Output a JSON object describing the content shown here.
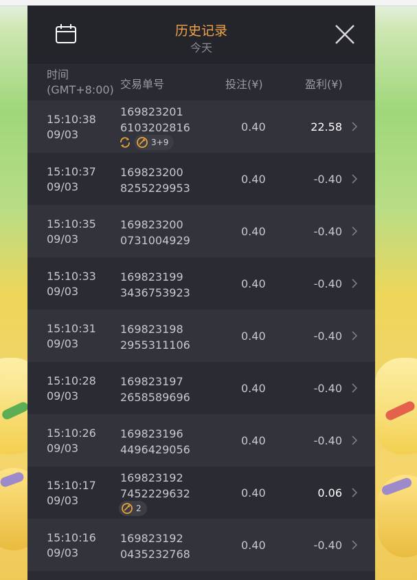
{
  "header": {
    "title": "历史记录",
    "subtitle": "今天",
    "calendar_icon": "calendar-icon",
    "close_icon": "close-icon"
  },
  "columns": {
    "time_line1": "时间",
    "time_line2": "(GMT+8:00)",
    "transaction_id": "交易单号",
    "bet": "投注(¥)",
    "profit": "盈利(¥)"
  },
  "colors": {
    "title": "#f0a44a",
    "panel_bg": "#2b2b33",
    "header_bg": "#24242b",
    "win": "#ffffff",
    "badge_icon": "#e8a43a"
  },
  "rows": [
    {
      "time": "15:10:38",
      "date": "09/03",
      "id_line1": "169823201",
      "id_line2": "6103202816",
      "bet": "0.40",
      "profit": "22.58",
      "win": true,
      "badges": {
        "respin_icon": "respin-icon",
        "feature_icon": "free-spin-icon",
        "count": "3+9"
      }
    },
    {
      "time": "15:10:37",
      "date": "09/03",
      "id_line1": "169823200",
      "id_line2": "8255229953",
      "bet": "0.40",
      "profit": "-0.40",
      "win": false
    },
    {
      "time": "15:10:35",
      "date": "09/03",
      "id_line1": "169823200",
      "id_line2": "0731004929",
      "bet": "0.40",
      "profit": "-0.40",
      "win": false
    },
    {
      "time": "15:10:33",
      "date": "09/03",
      "id_line1": "169823199",
      "id_line2": "3436753923",
      "bet": "0.40",
      "profit": "-0.40",
      "win": false
    },
    {
      "time": "15:10:31",
      "date": "09/03",
      "id_line1": "169823198",
      "id_line2": "2955311106",
      "bet": "0.40",
      "profit": "-0.40",
      "win": false
    },
    {
      "time": "15:10:28",
      "date": "09/03",
      "id_line1": "169823197",
      "id_line2": "2658589696",
      "bet": "0.40",
      "profit": "-0.40",
      "win": false
    },
    {
      "time": "15:10:26",
      "date": "09/03",
      "id_line1": "169823196",
      "id_line2": "4496429056",
      "bet": "0.40",
      "profit": "-0.40",
      "win": false
    },
    {
      "time": "15:10:17",
      "date": "09/03",
      "id_line1": "169823192",
      "id_line2": "7452229632",
      "bet": "0.40",
      "profit": "0.06",
      "win": true,
      "badges": {
        "feature_icon": "free-spin-icon",
        "count": "2"
      }
    },
    {
      "time": "15:10:16",
      "date": "09/03",
      "id_line1": "169823192",
      "id_line2": "0435232768",
      "bet": "0.40",
      "profit": "-0.40",
      "win": false
    }
  ]
}
